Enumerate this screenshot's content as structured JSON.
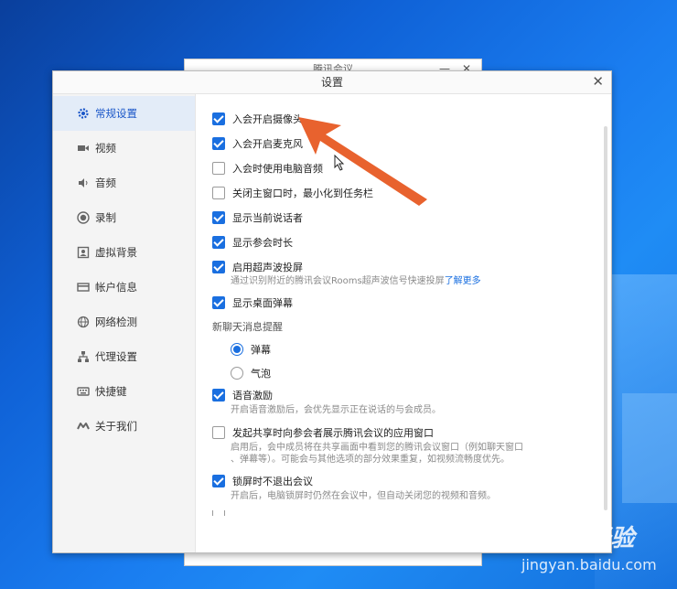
{
  "background_window": {
    "title": "腾讯会议",
    "minimize_label": "—",
    "close_label": "✕"
  },
  "window": {
    "title": "设置",
    "close_label": "✕"
  },
  "sidebar": {
    "items": [
      {
        "label": "常规设置",
        "icon": "gear-icon",
        "active": true
      },
      {
        "label": "视频",
        "icon": "video-icon"
      },
      {
        "label": "音频",
        "icon": "speaker-icon"
      },
      {
        "label": "录制",
        "icon": "record-icon"
      },
      {
        "label": "虚拟背景",
        "icon": "portrait-icon"
      },
      {
        "label": "帐户信息",
        "icon": "card-icon"
      },
      {
        "label": "网络检测",
        "icon": "globe-icon"
      },
      {
        "label": "代理设置",
        "icon": "network-icon"
      },
      {
        "label": "快捷键",
        "icon": "keyboard-icon"
      },
      {
        "label": "关于我们",
        "icon": "logo-icon"
      }
    ]
  },
  "settings": {
    "camera_on_join": {
      "label": "入会开启摄像头",
      "checked": true
    },
    "mic_on_join": {
      "label": "入会开启麦克风",
      "checked": true
    },
    "computer_audio": {
      "label": "入会时使用电脑音频",
      "checked": false
    },
    "minimize_to_tray": {
      "label": "关闭主窗口时，最小化到任务栏",
      "checked": false
    },
    "show_speaker": {
      "label": "显示当前说话者",
      "checked": true
    },
    "show_duration": {
      "label": "显示参会时长",
      "checked": true
    },
    "ultrasonic": {
      "label": "启用超声波投屏",
      "checked": true,
      "desc": "通过识别附近的腾讯会议Rooms超声波信号快速投屏",
      "link": "了解更多"
    },
    "desktop_popup": {
      "label": "显示桌面弹幕",
      "checked": true
    },
    "chat_section_label": "新聊天消息提醒",
    "chat_popup": {
      "label": "弹幕",
      "selected": true
    },
    "chat_bubble": {
      "label": "气泡",
      "selected": false
    },
    "voice_activation": {
      "label": "语音激励",
      "checked": true,
      "desc": "开启语音激励后，会优先显示正在说话的与会成员。"
    },
    "share_app_window": {
      "label": "发起共享时向参会者展示腾讯会议的应用窗口",
      "checked": false,
      "desc_line1": "启用后，会中成员将在共享画面中看到您的腾讯会议窗口（例如聊天窗口",
      "desc_line2": "、弹幕等）。可能会与其他选项的部分效果重复，如视频流畅度优先。"
    },
    "lock_screen": {
      "label": "锁屏时不退出会议",
      "checked": true,
      "desc": "开启后，电脑锁屏时仍然在会议中，但自动关闭您的视频和音频。"
    }
  },
  "watermark": {
    "main": "Baidu经验",
    "sub": "jingyan.baidu.com"
  },
  "colors": {
    "accent": "#1a6fe0",
    "arrow": "#e8622e",
    "sidebar_active_bg": "#e3ecf8"
  }
}
